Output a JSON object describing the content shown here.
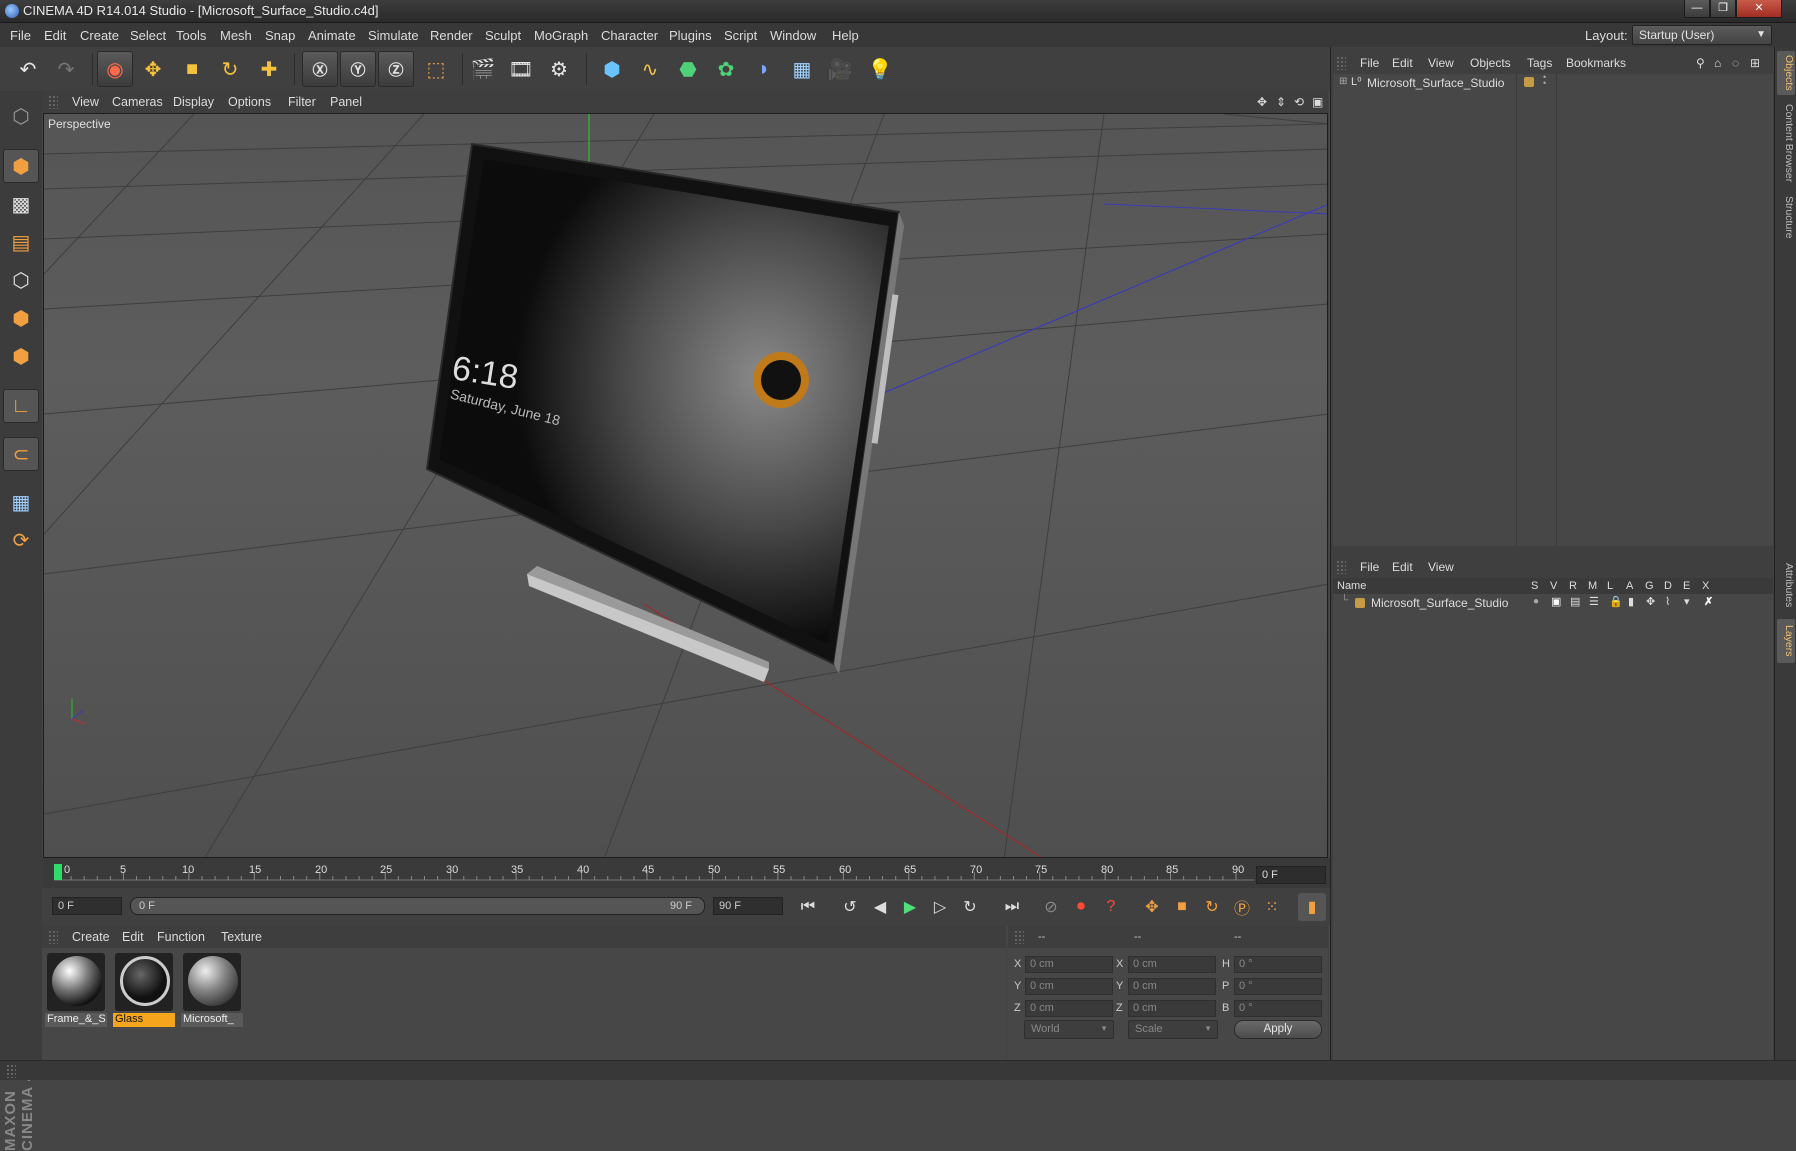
{
  "window": {
    "title": "CINEMA 4D R14.014 Studio - [Microsoft_Surface_Studio.c4d]",
    "minimize": "—",
    "restore": "❐",
    "close": "✕"
  },
  "menu": [
    "File",
    "Edit",
    "Create",
    "Select",
    "Tools",
    "Mesh",
    "Snap",
    "Animate",
    "Simulate",
    "Render",
    "Sculpt",
    "MoGraph",
    "Character",
    "Plugins",
    "Script",
    "Window",
    "Help"
  ],
  "layout": {
    "label": "Layout:",
    "value": "Startup (User)"
  },
  "viewport": {
    "menu": [
      "View",
      "Cameras",
      "Display",
      "Options",
      "Filter",
      "Panel"
    ],
    "label": "Perspective",
    "screen_time": "6:18",
    "screen_date": "Saturday, June 18"
  },
  "timeline": {
    "ticks": [
      "0",
      "5",
      "10",
      "15",
      "20",
      "25",
      "30",
      "35",
      "40",
      "45",
      "50",
      "55",
      "60",
      "65",
      "70",
      "75",
      "80",
      "85",
      "90"
    ],
    "current_frame": "0 F",
    "start_field": "0 F",
    "range_start": "0 F",
    "range_end": "90 F",
    "end_field": "90 F"
  },
  "materials": {
    "menu": [
      "Create",
      "Edit",
      "Function",
      "Texture"
    ],
    "items": [
      {
        "label": "Frame_&_S",
        "selected": false
      },
      {
        "label": "Glass",
        "selected": true
      },
      {
        "label": "Microsoft_",
        "selected": false
      }
    ]
  },
  "coordinates": {
    "headers": [
      "--",
      "--",
      "--"
    ],
    "rows": [
      {
        "l1": "X",
        "v1": "0 cm",
        "l2": "X",
        "v2": "0 cm",
        "l3": "H",
        "v3": "0 °"
      },
      {
        "l1": "Y",
        "v1": "0 cm",
        "l2": "Y",
        "v2": "0 cm",
        "l3": "P",
        "v3": "0 °"
      },
      {
        "l1": "Z",
        "v1": "0 cm",
        "l2": "Z",
        "v2": "0 cm",
        "l3": "B",
        "v3": "0 °"
      }
    ],
    "space": "World",
    "mode": "Scale",
    "apply": "Apply"
  },
  "object_manager": {
    "menu": [
      "File",
      "Edit",
      "View",
      "Objects",
      "Tags",
      "Bookmarks"
    ],
    "object": "Microsoft_Surface_Studio"
  },
  "layer_manager": {
    "menu": [
      "File",
      "Edit",
      "View"
    ],
    "columns": [
      "Name",
      "S",
      "V",
      "R",
      "M",
      "L",
      "A",
      "G",
      "D",
      "E",
      "X"
    ],
    "layer": "Microsoft_Surface_Studio"
  },
  "side_tabs": [
    "Objects",
    "Content Browser",
    "Structure",
    "Attributes",
    "Layers"
  ],
  "logo": "MAXON CINEMA 4D",
  "colors": {
    "accent": "#e8a030",
    "glass_tag": "#f4a51c",
    "layer_color": "#c79a45"
  }
}
